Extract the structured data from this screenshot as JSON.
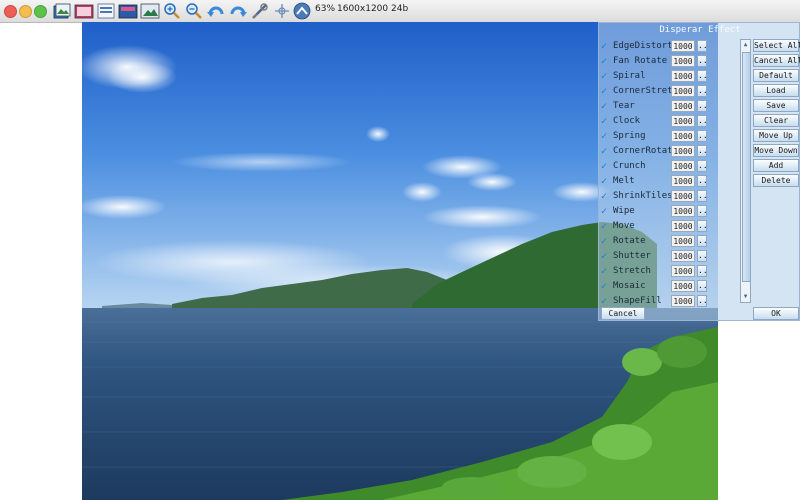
{
  "toolbar": {
    "zoom": "63%",
    "info": "1600x1200 24b"
  },
  "dialog": {
    "title": "Disperar Effect",
    "effects": [
      {
        "name": "EdgeDistort",
        "value": "1000"
      },
      {
        "name": "Fan Rotate",
        "value": "1000"
      },
      {
        "name": "Spiral",
        "value": "1000"
      },
      {
        "name": "CornerStretch",
        "value": "1000"
      },
      {
        "name": "Tear",
        "value": "1000"
      },
      {
        "name": "Clock",
        "value": "1000"
      },
      {
        "name": "Spring",
        "value": "1000"
      },
      {
        "name": "CornerRotate",
        "value": "1000"
      },
      {
        "name": "Crunch",
        "value": "1000"
      },
      {
        "name": "Melt",
        "value": "1000"
      },
      {
        "name": "ShrinkTiles",
        "value": "1000"
      },
      {
        "name": "Wipe",
        "value": "1000"
      },
      {
        "name": "Move",
        "value": "1000"
      },
      {
        "name": "Rotate",
        "value": "1000"
      },
      {
        "name": "Shutter",
        "value": "1000"
      },
      {
        "name": "Stretch",
        "value": "1000"
      },
      {
        "name": "Mosaic",
        "value": "1000"
      },
      {
        "name": "ShapeFill",
        "value": "1000"
      }
    ],
    "more_label": "..",
    "check_mark": "✓",
    "side_buttons": [
      "Select All",
      "Cancel All",
      "Default",
      "Load",
      "Save",
      "Clear",
      "Move Up",
      "Move Down",
      "Add",
      "Delete"
    ],
    "cancel_label": "Cancel",
    "ok_label": "OK"
  }
}
